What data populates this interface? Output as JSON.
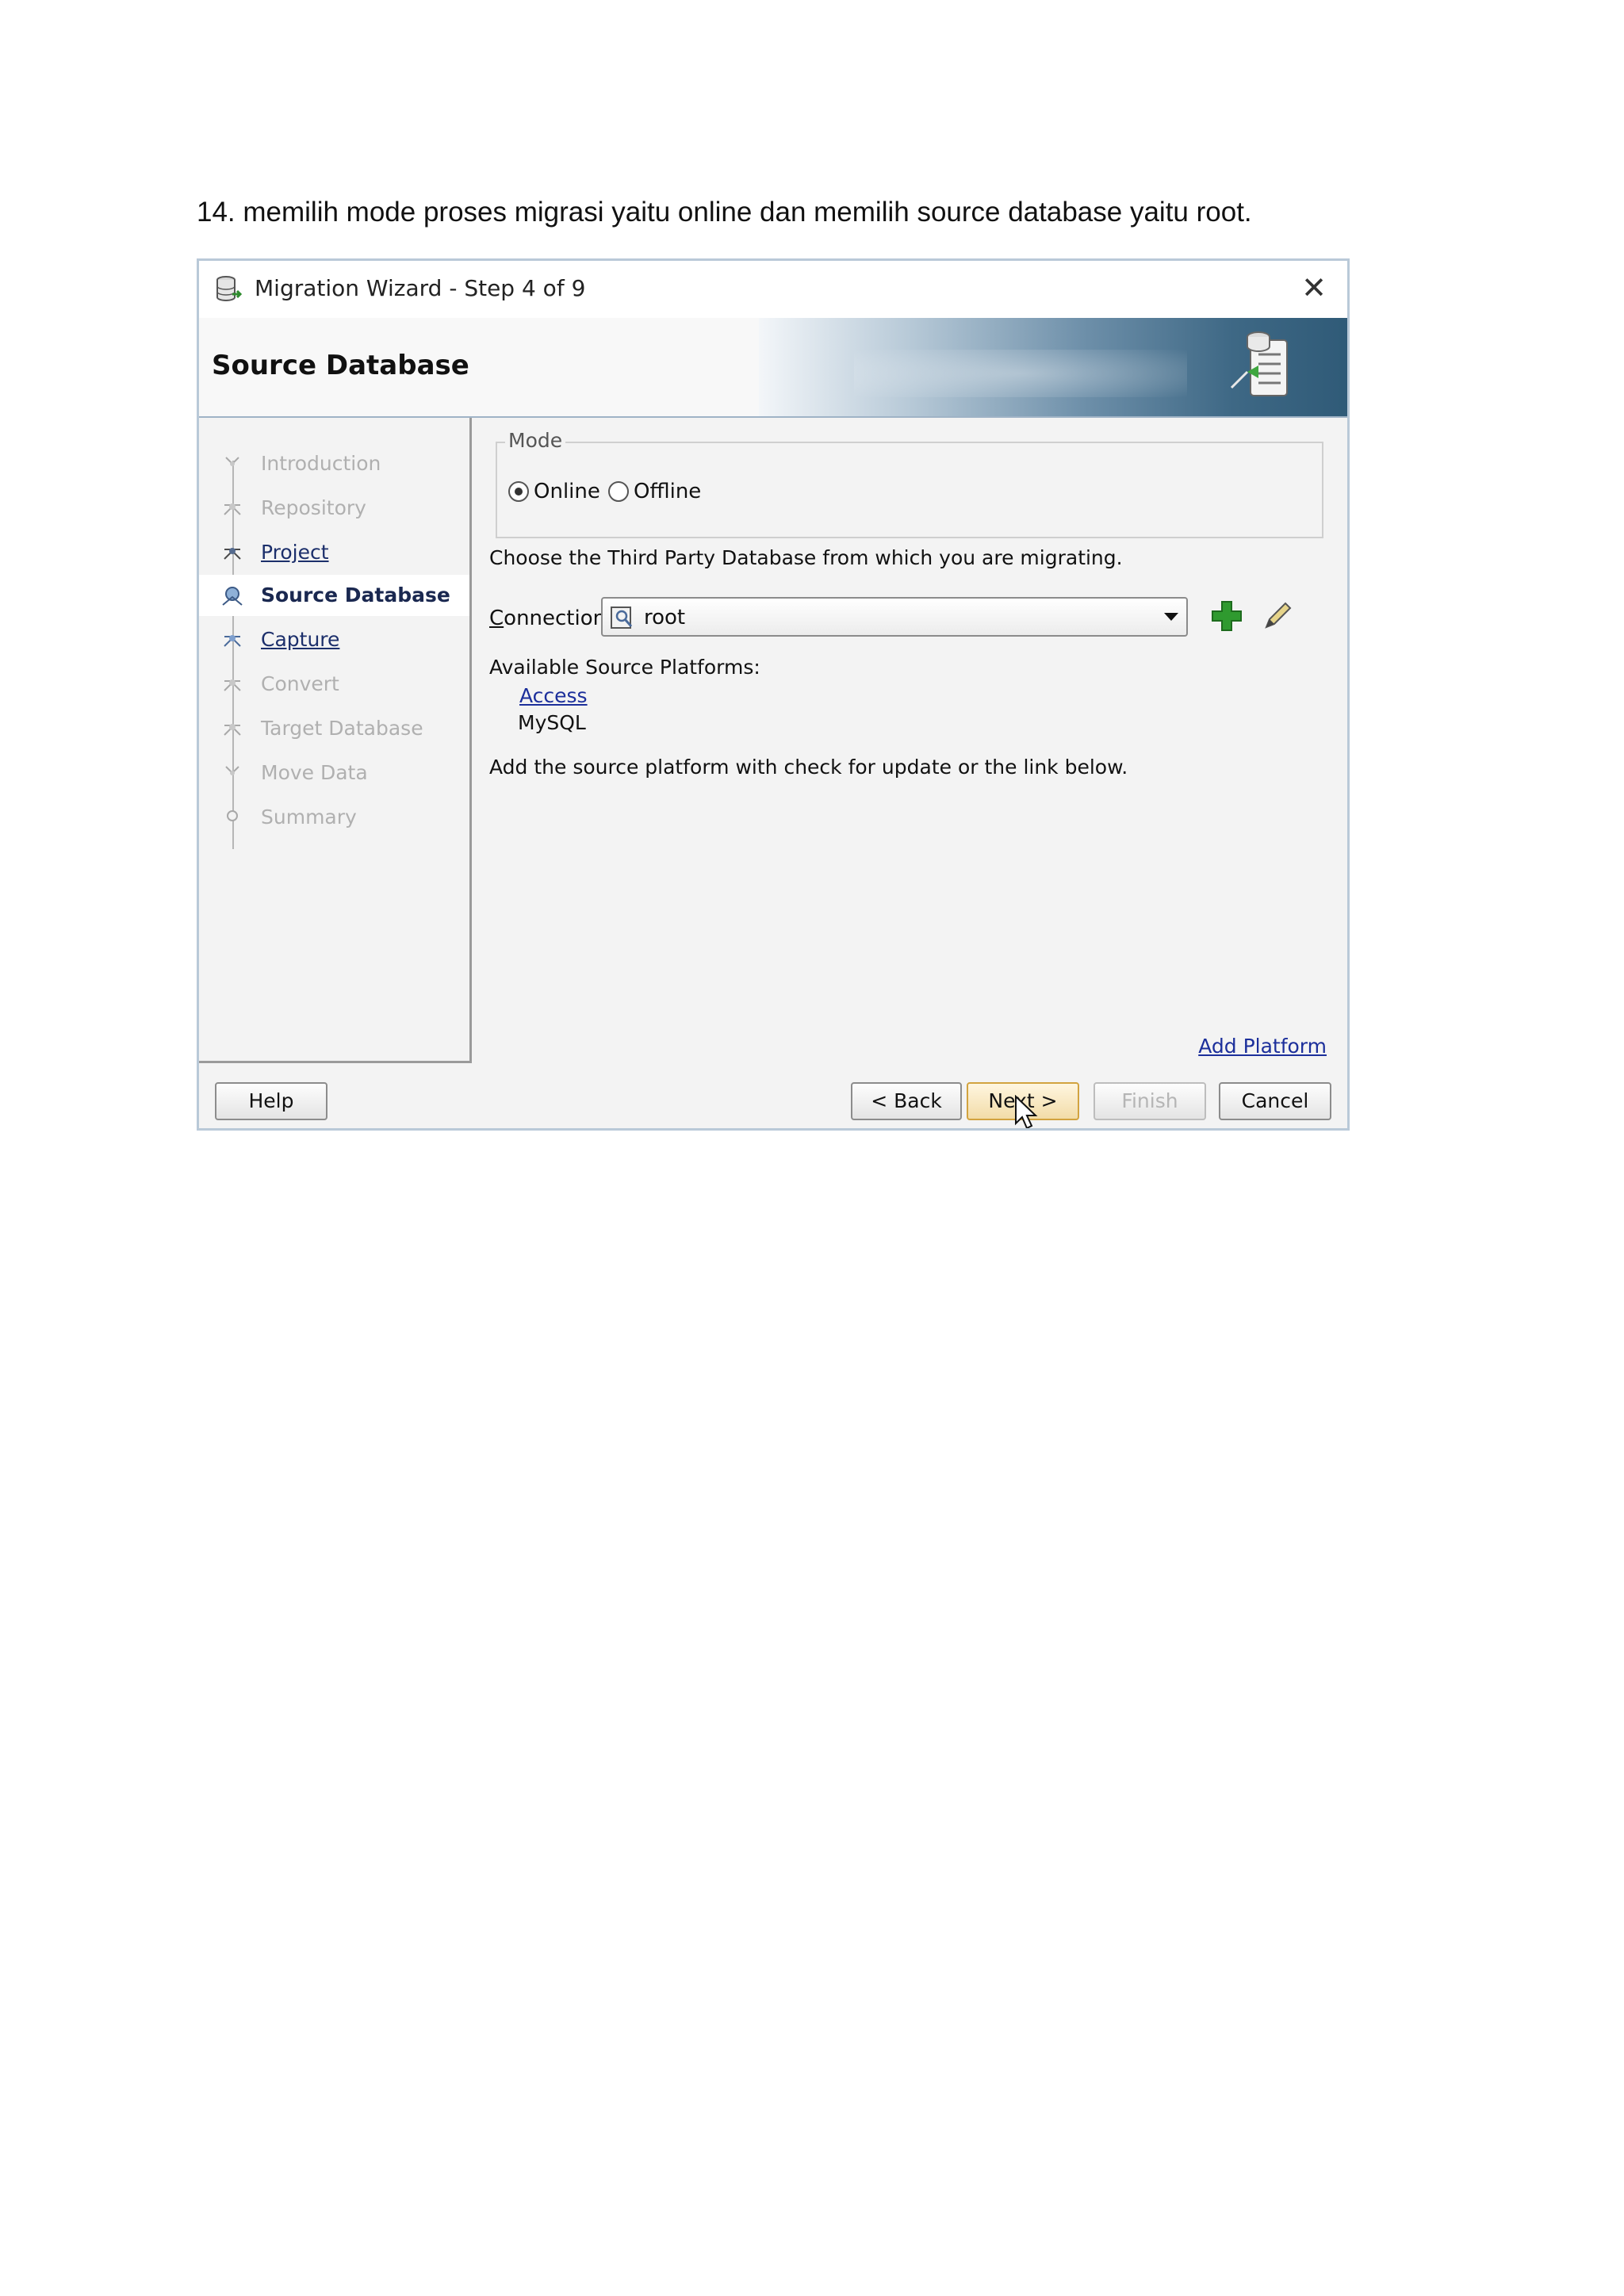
{
  "caption": "14. memilih mode proses migrasi yaitu online dan memilih source database yaitu root.",
  "wizard": {
    "window_title": "Migration Wizard - Step 4 of 9",
    "close_symbol": "✕",
    "section_title": "Source Database",
    "steps": [
      {
        "label": "Introduction",
        "state": "disabled"
      },
      {
        "label": "Repository",
        "state": "disabled"
      },
      {
        "label": "Project",
        "state": "link"
      },
      {
        "label": "Source Database",
        "state": "active"
      },
      {
        "label": "Capture ",
        "state": "link"
      },
      {
        "label": "Convert",
        "state": "disabled"
      },
      {
        "label": "Target Database",
        "state": "disabled"
      },
      {
        "label": "Move Data",
        "state": "disabled"
      },
      {
        "label": "Summary",
        "state": "disabled"
      }
    ],
    "mode": {
      "legend": "Mode",
      "online_label": "Online",
      "offline_label": "Offline",
      "selected": "online"
    },
    "instruction": "Choose the Third Party Database from which you are migrating.",
    "connection": {
      "label_first": "C",
      "label_rest": "onnection:",
      "value": "root"
    },
    "platforms": {
      "label": "Available Source Platforms:",
      "access": "Access",
      "mysql": "MySQL"
    },
    "hint": "Add the source platform with check for update or the link below.",
    "add_platform": "Add Platform",
    "buttons": {
      "help": "Help",
      "back": "< Back",
      "next": "Next >",
      "finish": "Finish",
      "cancel": "Cancel"
    }
  }
}
